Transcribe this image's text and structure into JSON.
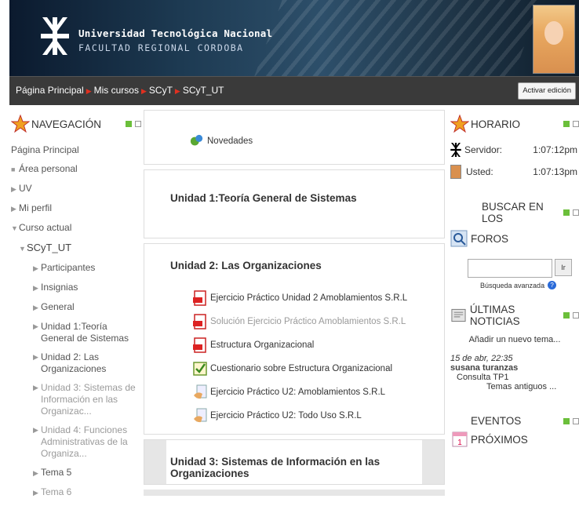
{
  "header": {
    "university": "Universidad Tecnológica Nacional",
    "faculty": "FACULTAD REGIONAL CORDOBA"
  },
  "breadcrumb": [
    "Página Principal",
    "Mis cursos",
    "SCyT",
    "SCyT_UT"
  ],
  "edit_button": "Activar edición",
  "nav": {
    "title": "NAVEGACIÓN",
    "items": [
      {
        "label": "Página Principal",
        "mark": ""
      },
      {
        "label": "Área personal",
        "mark": "■"
      },
      {
        "label": "UV",
        "mark": "▶"
      },
      {
        "label": "Mi perfil",
        "mark": "▶"
      },
      {
        "label": "Curso actual",
        "mark": "▼"
      }
    ],
    "course": "SCyT_UT",
    "course_items": [
      "Participantes",
      "Insignias",
      "General",
      "Unidad 1:Teoría General de Sistemas",
      "Unidad 2: Las Organizaciones",
      "Unidad 3: Sistemas de Información en las Organizac...",
      "Unidad 4: Funciones Administrativas de la Organiza...",
      "Tema 5",
      "Tema 6"
    ]
  },
  "main": {
    "news": "Novedades",
    "unit1": "Unidad 1:Teoría General de Sistemas",
    "unit2": "Unidad 2: Las Organizaciones",
    "unit2_items": [
      {
        "label": "Ejercicio Práctico Unidad 2 Amoblamientos S.R.L",
        "icon": "pdf-icon",
        "dim": false
      },
      {
        "label": "Solución Ejercicio Práctico Amoblamientos S.R.L",
        "icon": "pdf-icon",
        "dim": true
      },
      {
        "label": "Estructura Organizacional",
        "icon": "pdf-icon",
        "dim": false
      },
      {
        "label": "Cuestionario sobre Estructura Organizacional",
        "icon": "quiz-icon",
        "dim": false
      },
      {
        "label": "Ejercicio Práctico U2: Amoblamientos S.R.L",
        "icon": "assignment-icon",
        "dim": false
      },
      {
        "label": "Ejercicio Práctico U2: Todo Uso S.R.L",
        "icon": "assignment-icon",
        "dim": false
      }
    ],
    "unit3": "Unidad 3: Sistemas de Información en las Organizaciones"
  },
  "schedule": {
    "title": "HORARIO",
    "server_label": "Servidor:",
    "server_time": "1:07:12pm",
    "user_label": "Usted:",
    "user_time": "1:07:13pm"
  },
  "search": {
    "title_line1": "BUSCAR EN LOS",
    "title_line2": "FOROS",
    "button": "Ir",
    "advanced": "Búsqueda avanzada"
  },
  "news_block": {
    "title": "ÚLTIMAS NOTICIAS",
    "add": "Añadir un nuevo tema...",
    "date": "15 de abr, 22:35",
    "author": "susana turanzas",
    "subject": "Consulta TP1",
    "older": "Temas antiguos ..."
  },
  "events": {
    "title_line1": "EVENTOS",
    "title_line2": "PRÓXIMOS"
  }
}
